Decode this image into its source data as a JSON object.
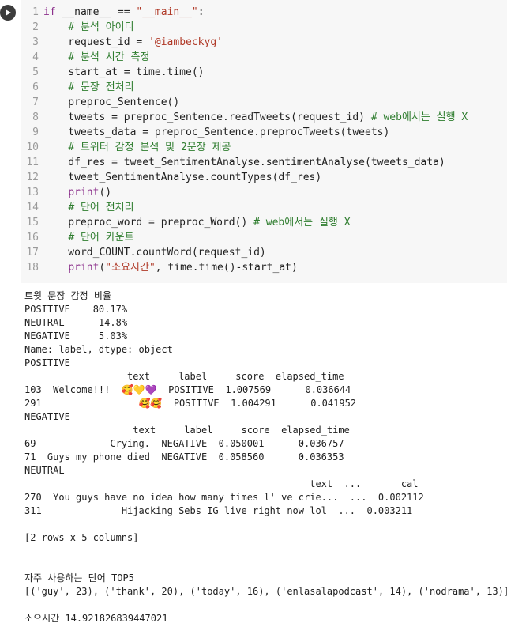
{
  "code": {
    "lines": [
      {
        "n": "1",
        "segments": [
          {
            "k": "kw",
            "t": "if"
          },
          {
            "k": "",
            "t": " __name__ == "
          },
          {
            "k": "str",
            "t": "\"__main__\""
          },
          {
            "k": "",
            "t": ":"
          }
        ]
      },
      {
        "n": "2",
        "segments": [
          {
            "k": "",
            "t": "    "
          },
          {
            "k": "cmt",
            "t": "# 분석 아이디"
          }
        ]
      },
      {
        "n": "3",
        "segments": [
          {
            "k": "",
            "t": "    request_id = "
          },
          {
            "k": "str",
            "t": "'@iambeckyg'"
          }
        ]
      },
      {
        "n": "4",
        "segments": [
          {
            "k": "",
            "t": "    "
          },
          {
            "k": "cmt",
            "t": "# 분석 시간 측정"
          }
        ]
      },
      {
        "n": "5",
        "segments": [
          {
            "k": "",
            "t": "    start_at = time.time()"
          }
        ]
      },
      {
        "n": "6",
        "segments": [
          {
            "k": "",
            "t": "    "
          },
          {
            "k": "cmt",
            "t": "# 문장 전처리"
          }
        ]
      },
      {
        "n": "7",
        "segments": [
          {
            "k": "",
            "t": "    preproc_Sentence()"
          }
        ]
      },
      {
        "n": "8",
        "segments": [
          {
            "k": "",
            "t": "    tweets = preproc_Sentence.readTweets(request_id) "
          },
          {
            "k": "cmt",
            "t": "# web에서는 실행 X"
          }
        ]
      },
      {
        "n": "9",
        "segments": [
          {
            "k": "",
            "t": "    tweets_data = preproc_Sentence.preprocTweets(tweets)"
          }
        ]
      },
      {
        "n": "10",
        "segments": [
          {
            "k": "",
            "t": "    "
          },
          {
            "k": "cmt",
            "t": "# 트위터 감정 분석 및 2문장 제공"
          }
        ]
      },
      {
        "n": "11",
        "segments": [
          {
            "k": "",
            "t": "    df_res = tweet_SentimentAnalyse.sentimentAnalyse(tweets_data)"
          }
        ]
      },
      {
        "n": "12",
        "segments": [
          {
            "k": "",
            "t": "    tweet_SentimentAnalyse.countTypes(df_res)"
          }
        ]
      },
      {
        "n": "13",
        "segments": [
          {
            "k": "",
            "t": "    "
          },
          {
            "k": "fn",
            "t": "print"
          },
          {
            "k": "",
            "t": "()"
          }
        ]
      },
      {
        "n": "14",
        "segments": [
          {
            "k": "",
            "t": "    "
          },
          {
            "k": "cmt",
            "t": "# 단어 전처리"
          }
        ]
      },
      {
        "n": "15",
        "segments": [
          {
            "k": "",
            "t": "    preproc_word = preproc_Word() "
          },
          {
            "k": "cmt",
            "t": "# web에서는 실행 X"
          }
        ]
      },
      {
        "n": "16",
        "segments": [
          {
            "k": "",
            "t": "    "
          },
          {
            "k": "cmt",
            "t": "# 단어 카운트"
          }
        ]
      },
      {
        "n": "17",
        "segments": [
          {
            "k": "",
            "t": "    word_COUNT.countWord(request_id)"
          }
        ]
      },
      {
        "n": "18",
        "segments": [
          {
            "k": "",
            "t": "    "
          },
          {
            "k": "fn",
            "t": "print"
          },
          {
            "k": "",
            "t": "("
          },
          {
            "k": "str",
            "t": "\"소요시간\""
          },
          {
            "k": "",
            "t": ", time.time()-start_at)"
          }
        ]
      }
    ]
  },
  "output": {
    "lines": [
      "트윗 문장 감정 비율",
      "POSITIVE    80.17%",
      "NEUTRAL      14.8%",
      "NEGATIVE     5.03%",
      "Name: label, dtype: object",
      "POSITIVE",
      "                  text     label     score  elapsed_time",
      "103  Welcome!!!  🥰💛💜  POSITIVE  1.007569      0.036644",
      "291                 🥰🥰  POSITIVE  1.004291      0.041952",
      "NEGATIVE",
      "                   text     label     score  elapsed_time",
      "69             Crying.  NEGATIVE  0.050001      0.036757",
      "71  Guys my phone died  NEGATIVE  0.058560      0.036353",
      "NEUTRAL",
      "                                                  text  ...       cal",
      "270  You guys have no idea how many times l' ve crie...  ...  0.002112",
      "311              Hijacking Sebs IG live right now lol  ...  0.003211",
      "",
      "[2 rows x 5 columns]",
      "",
      "",
      "자주 사용하는 단어 TOP5",
      "[('guy', 23), ('thank', 20), ('today', 16), ('enlasalapodcast', 14), ('nodrama', 13)]",
      "",
      "소요시간 14.921826839447021"
    ]
  }
}
